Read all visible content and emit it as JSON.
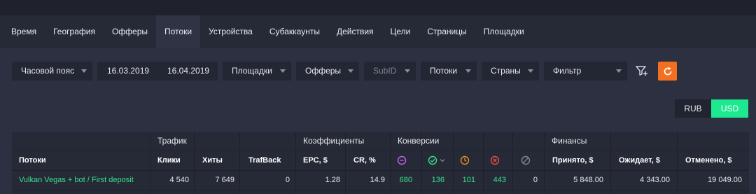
{
  "tabs": [
    "Время",
    "География",
    "Офферы",
    "Потоки",
    "Устройства",
    "Субаккаунты",
    "Действия",
    "Цели",
    "Страницы",
    "Площадки"
  ],
  "active_tab": "Потоки",
  "filters": {
    "timezone": "Часовой пояс",
    "date_from": "16.03.2019",
    "date_to": "16.04.2019",
    "sites": "Площадки",
    "offers": "Офферы",
    "subid": "SubID",
    "streams": "Потоки",
    "countries": "Страны",
    "filter": "Фильтр"
  },
  "currency": {
    "rub": "RUB",
    "usd": "USD",
    "selected": "USD"
  },
  "table": {
    "groups": {
      "traffic": "Трафик",
      "coefficients": "Коэффициенты",
      "conversions": "Конверсии",
      "finances": "Финансы"
    },
    "headers": {
      "stream": "Потоки",
      "clicks": "Клики",
      "hits": "Хиты",
      "trafback": "TrafBack",
      "epc": "EPC, $",
      "cr": "CR, %",
      "accepted": "Принято, $",
      "pending": "Ожидает, $",
      "rejected": "Отменено, $"
    },
    "conversion_icons": [
      "pending-circle-icon",
      "approved-check-icon",
      "hold-clock-icon",
      "rejected-x-icon",
      "trash-slash-icon"
    ],
    "colors": {
      "purple": "#c065e8",
      "green": "#39e08a",
      "orange": "#f0872b",
      "red": "#e84a4a",
      "gray": "#7e8496"
    },
    "row": {
      "stream": "Vulkan Vegas + bot / First deposit",
      "clicks": "4 540",
      "hits": "7 649",
      "trafback": "0",
      "epc": "1.28",
      "cr": "14.9",
      "conv_pending": "680",
      "conv_approved": "136",
      "conv_hold": "101",
      "conv_rejected": "443",
      "conv_trash": "0",
      "accepted": "5 848.00",
      "pending": "4 343.00",
      "rejected": "19 049.00"
    }
  }
}
